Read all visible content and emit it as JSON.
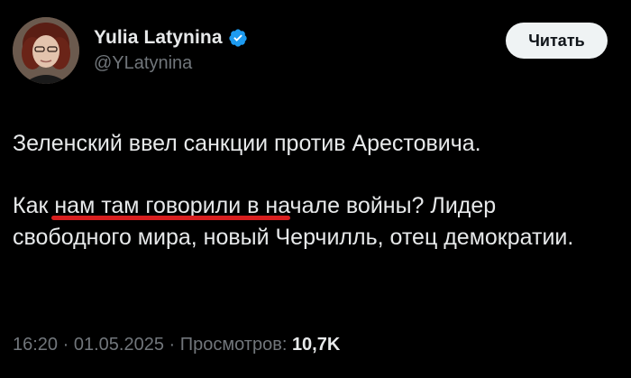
{
  "author": {
    "display_name": "Yulia Latynina",
    "handle": "@YLatynina",
    "verified": true
  },
  "follow_button": {
    "label": "Читать"
  },
  "tweet": {
    "paragraph_1": "Зеленский ввел санкции против Арестовича.",
    "paragraph_2_before": "Как ",
    "paragraph_2_underlined": "нам там говорили",
    "paragraph_2_after": " в начале войны? Лидер свободного мира, новый Черчилль, отец демократии."
  },
  "meta": {
    "time": "16:20",
    "separator": " · ",
    "date": "01.05.2025",
    "views_label": "Просмотров: ",
    "views_count": "10,7K"
  },
  "colors": {
    "background": "#000000",
    "text": "#e7e9ea",
    "secondary_text": "#71767b",
    "verified_badge": "#1d9bf0",
    "underline": "#d81f1f",
    "follow_button_bg": "#eff3f4"
  },
  "icons": {
    "verified": "verified-badge-icon"
  }
}
